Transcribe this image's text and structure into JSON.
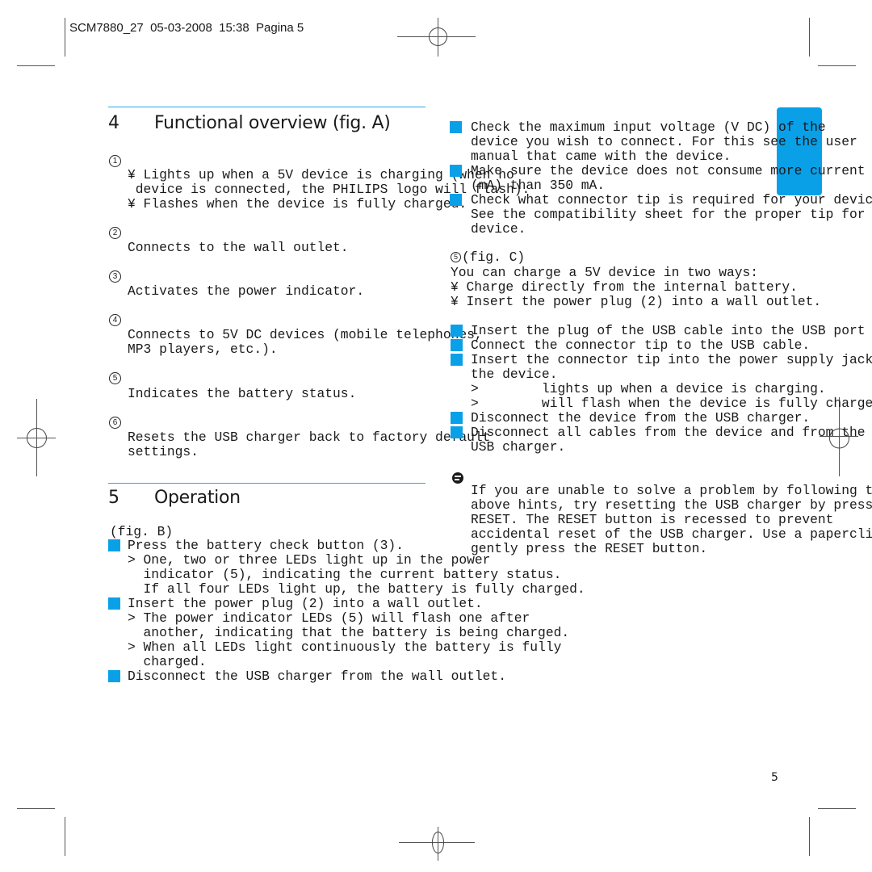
{
  "header": {
    "slug": "SCM7880_27  05-03-2008  15:38  Pagina 5"
  },
  "accent_color": "#0aa0e8",
  "section4": {
    "number": "4",
    "title": "Functional overview (fig. A)",
    "items": [
      {
        "marker": "1",
        "lines": [
          "¥ Lights up when a 5V device is charging (when no",
          " device is connected, the PHILIPS logo will flash).",
          "¥ Flashes when the device is fully charged."
        ]
      },
      {
        "marker": "2",
        "lines": [
          "Connects to the wall outlet."
        ]
      },
      {
        "marker": "3",
        "lines": [
          "Activates the power indicator."
        ]
      },
      {
        "marker": "4",
        "lines": [
          "Connects to 5V DC devices (mobile telephones,",
          "MP3 players, etc.)."
        ]
      },
      {
        "marker": "5",
        "lines": [
          "Indicates the battery status."
        ]
      },
      {
        "marker": "6",
        "lines": [
          "Resets the USB charger back to factory default",
          "settings."
        ]
      }
    ]
  },
  "section5": {
    "number": "5",
    "title": "Operation",
    "fig": "(fig. B)",
    "steps": [
      {
        "text": "Press the battery check button (3).",
        "sub": [
          "> One, two or three LEDs light up in the power",
          "  indicator (5), indicating the current battery status.",
          "  If all four LEDs light up, the battery is fully charged."
        ]
      },
      {
        "text": "Insert the power plug (2) into a wall outlet.",
        "sub": [
          "> The power indicator LEDs (5) will flash one after",
          "  another, indicating that the battery is being charged.",
          "> When all LEDs light continuously the battery is fully",
          "  charged."
        ]
      },
      {
        "text": "Disconnect the USB charger from the wall outlet.",
        "sub": []
      }
    ]
  },
  "right": {
    "checks": [
      {
        "lines": [
          "Check the maximum input voltage (V DC) of the",
          "device you wish to connect. For this see the user",
          "manual that came with the device."
        ]
      },
      {
        "lines": [
          "Make sure the device does not consume more current",
          "(mA) than 350 mA."
        ]
      },
      {
        "lines": [
          "Check what connector tip is required for your device.",
          "See the compatibility sheet for the proper tip for",
          "device."
        ]
      }
    ],
    "fig_marker": "5",
    "fig_label": "(fig. C)",
    "intro": [
      "You can charge a 5V device in two ways:",
      "¥ Charge directly from the internal battery.",
      "¥ Insert the power plug (2) into a wall outlet."
    ],
    "steps": [
      {
        "lines": [
          "Insert the plug of the USB cable into the USB port"
        ]
      },
      {
        "lines": [
          "Connect the connector tip to the USB cable."
        ]
      },
      {
        "lines": [
          "Insert the connector tip into the power supply jack",
          "the device.",
          ">        lights up when a device is charging.",
          ">        will flash when the device is fully charged."
        ]
      },
      {
        "lines": [
          "Disconnect the device from the USB charger."
        ]
      },
      {
        "lines": [
          "Disconnect all cables from the device and from the",
          "USB charger."
        ]
      }
    ],
    "note": [
      "If you are unable to solve a problem by following the",
      "above hints, try resetting the USB charger by pressing",
      "RESET. The RESET button is recessed to prevent",
      "accidental reset of the USB charger. Use a paperclip",
      "gently press the RESET button."
    ]
  },
  "footer": {
    "page_number": "5"
  }
}
